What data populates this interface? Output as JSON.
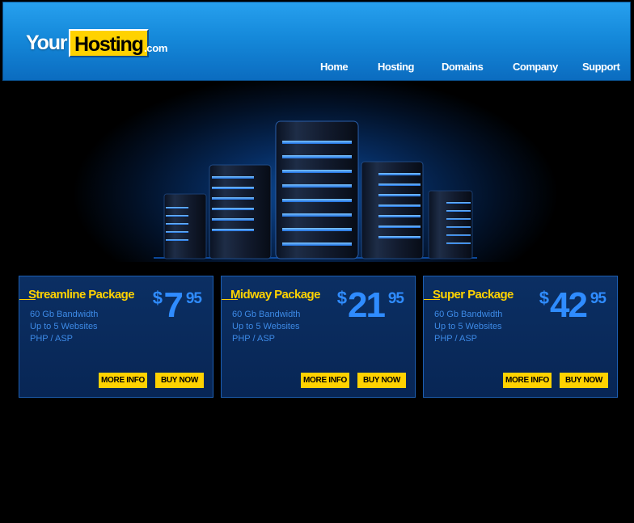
{
  "logo": {
    "part1": "Your",
    "part2": "Hosting",
    "suffix": ".com"
  },
  "nav": [
    "Home",
    "Hosting",
    "Domains",
    "Company",
    "Support"
  ],
  "packages": [
    {
      "title": "Streamline Package",
      "currency": "$",
      "price_main": "7",
      "price_cents": "95",
      "features": [
        "60 Gb Bandwidth",
        "Up to 5 Websites",
        "PHP / ASP"
      ],
      "more_label": "MORE INFO",
      "buy_label": "BUY NOW"
    },
    {
      "title": "Midway Package",
      "currency": "$",
      "price_main": "21",
      "price_cents": "95",
      "features": [
        "60 Gb Bandwidth",
        "Up to 5 Websites",
        "PHP / ASP"
      ],
      "more_label": "MORE INFO",
      "buy_label": "BUY NOW"
    },
    {
      "title": "Super Package",
      "currency": "$",
      "price_main": "42",
      "price_cents": "95",
      "features": [
        "60 Gb Bandwidth",
        "Up to 5 Websites",
        "PHP / ASP"
      ],
      "more_label": "MORE INFO",
      "buy_label": "BUY NOW"
    }
  ],
  "colors": {
    "header_blue": "#1589da",
    "accent_yellow": "#ffd200",
    "price_blue": "#2f8cff",
    "card_bg": "#0b2f63"
  },
  "hero_icon": "server-towers-image"
}
